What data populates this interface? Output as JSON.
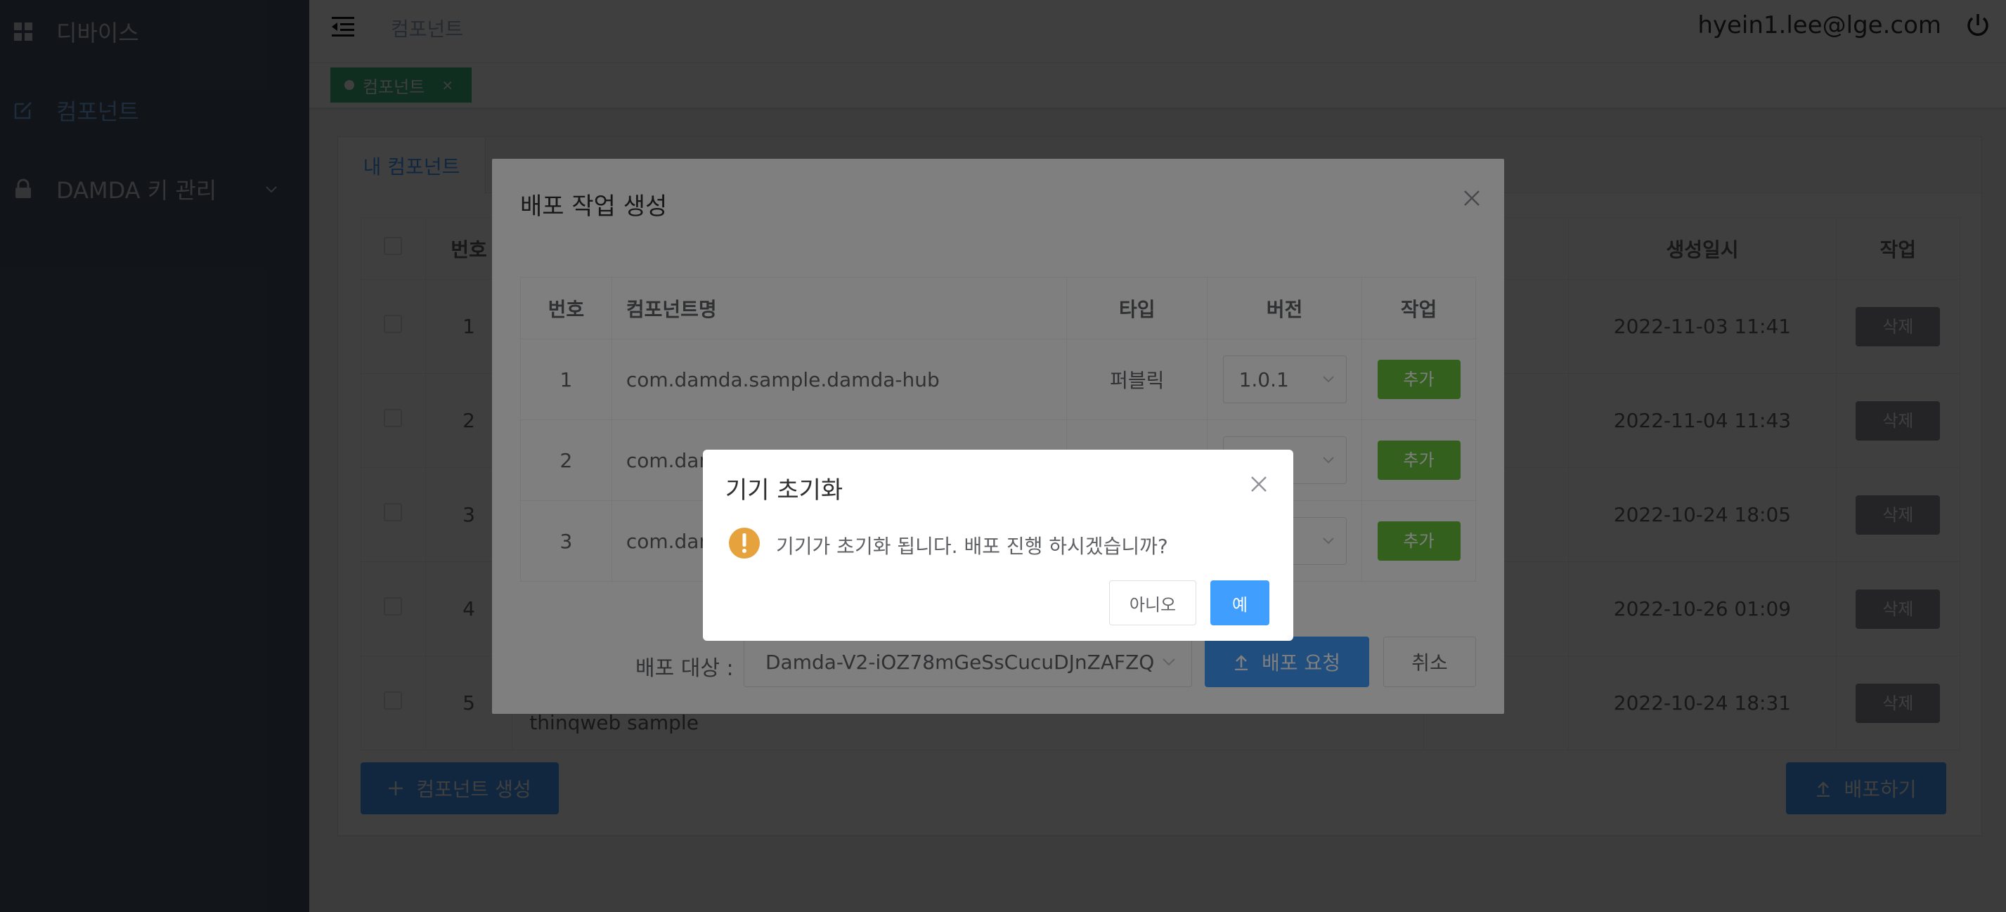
{
  "sidebar": {
    "items": [
      {
        "label": "디바이스",
        "icon": "grid-icon"
      },
      {
        "label": "컴포넌트",
        "icon": "edit-icon",
        "active": true
      },
      {
        "label": "DAMDA 키 관리",
        "icon": "lock-icon"
      }
    ]
  },
  "header": {
    "breadcrumb": "컴포넌트",
    "user_email": "hyein1.lee@lge.com"
  },
  "tags": {
    "active_tag": "컴포넌트",
    "close_glyph": "×"
  },
  "panel": {
    "tab_label": "내 컴포넌트",
    "table": {
      "headers": {
        "no": "번호",
        "created": "생성일시",
        "action": "작업"
      },
      "rows": [
        {
          "no": "1",
          "created": "2022-11-03 11:41",
          "action": "삭제"
        },
        {
          "no": "2",
          "created": "2022-11-04 11:43",
          "action": "삭제"
        },
        {
          "no": "3",
          "created": "2022-10-24 18:05",
          "action": "삭제"
        },
        {
          "no": "4",
          "created": "2022-10-26 01:09",
          "action": "삭제"
        },
        {
          "no": "5",
          "created": "2022-10-24 18:31",
          "action": "삭제",
          "desc": "thinqweb sample"
        }
      ]
    },
    "create_button": "컴포넌트 생성",
    "deploy_button": "배포하기"
  },
  "deploy_dialog": {
    "title": "배포 작업 생성",
    "headers": {
      "no": "번호",
      "name": "컴포넌트명",
      "type": "타입",
      "version": "버전",
      "action": "작업"
    },
    "rows": [
      {
        "no": "1",
        "name": "com.damda.sample.damda-hub",
        "type": "퍼블릭",
        "version": "1.0.1",
        "action": "추가"
      },
      {
        "no": "2",
        "name": "com.dam",
        "type": "",
        "version": "",
        "action": "추가"
      },
      {
        "no": "3",
        "name": "com.dam",
        "type": "",
        "version": "",
        "action": "추가"
      }
    ],
    "target_label": "배포 대상 :",
    "target_value": "Damda-V2-iOZ78mGeSsCucuDJnZAFZQ",
    "request_button": "배포 요청",
    "cancel_button": "취소"
  },
  "confirm_dialog": {
    "title": "기기 초기화",
    "message": "기기가 초기화 됩니다. 배포 진행 하시겠습니까?",
    "no_button": "아니오",
    "yes_button": "예",
    "warning_color": "#e6a23c"
  },
  "colors": {
    "sidebar_bg": "#475366",
    "primary": "#409eff",
    "success": "#67c23a",
    "tag": "#42b983",
    "danger_gray": "#909399"
  }
}
